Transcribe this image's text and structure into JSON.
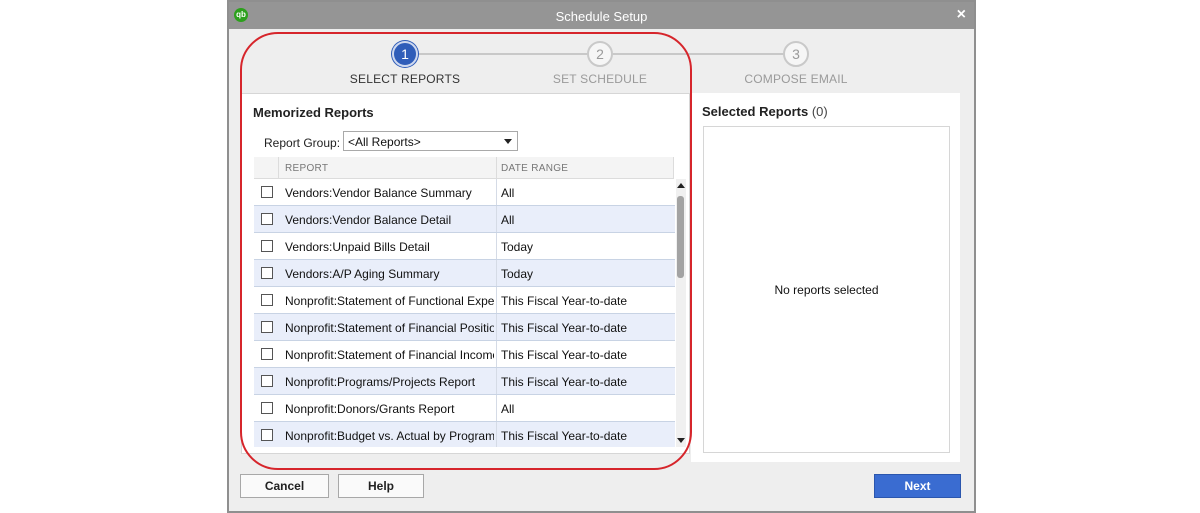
{
  "window": {
    "title": "Schedule Setup",
    "logo": "qb",
    "close": "×"
  },
  "steps": [
    {
      "number": "1",
      "label": "SELECT REPORTS",
      "state": "active"
    },
    {
      "number": "2",
      "label": "SET SCHEDULE",
      "state": "inactive"
    },
    {
      "number": "3",
      "label": "COMPOSE EMAIL",
      "state": "inactive"
    }
  ],
  "memorized": {
    "heading": "Memorized Reports",
    "group_label": "Report Group:",
    "group_value": "<All Reports>",
    "columns": {
      "report": "REPORT",
      "date_range": "DATE RANGE"
    },
    "rows": [
      {
        "report": "Vendors:Vendor Balance Summary",
        "date_range": "All"
      },
      {
        "report": "Vendors:Vendor Balance Detail",
        "date_range": "All"
      },
      {
        "report": "Vendors:Unpaid Bills Detail",
        "date_range": "Today"
      },
      {
        "report": "Vendors:A/P Aging Summary",
        "date_range": "Today"
      },
      {
        "report": "Nonprofit:Statement of Functional Expenses",
        "date_range": "This Fiscal Year-to-date"
      },
      {
        "report": "Nonprofit:Statement of Financial Position",
        "date_range": "This Fiscal Year-to-date"
      },
      {
        "report": "Nonprofit:Statement of Financial Income and",
        "date_range": "This Fiscal Year-to-date"
      },
      {
        "report": "Nonprofit:Programs/Projects Report",
        "date_range": "This Fiscal Year-to-date"
      },
      {
        "report": "Nonprofit:Donors/Grants Report",
        "date_range": "All"
      },
      {
        "report": "Nonprofit:Budget vs. Actual by Program/Proj",
        "date_range": "This Fiscal Year-to-date"
      }
    ]
  },
  "selected": {
    "heading": "Selected Reports",
    "count": "(0)",
    "empty_message": "No reports selected"
  },
  "buttons": {
    "cancel": "Cancel",
    "help": "Help",
    "next": "Next"
  },
  "colors": {
    "accent": "#3a6cd1",
    "highlight": "#d6252b",
    "row_alt": "#e9eefa"
  }
}
